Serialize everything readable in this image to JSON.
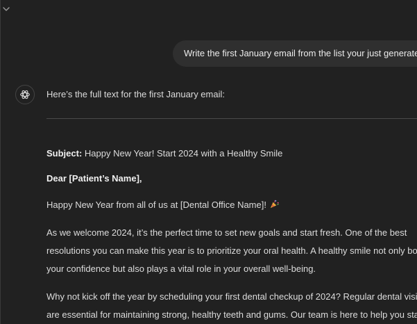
{
  "user_message": "Write the first January email from the list your just generated",
  "assistant": {
    "intro": "Here’s the full text for the first January email:",
    "email": {
      "subject_label": "Subject:",
      "subject_text": " Happy New Year! Start 2024 with a Healthy Smile",
      "greeting": "Dear [Patient’s Name],",
      "new_year_line": "Happy New Year from all of us at [Dental Office Name]!",
      "party_emoji": "party-popper-icon",
      "paragraph1": [
        "As we welcome 2024, it’s the perfect time to set new goals and start fresh. One of the best",
        "resolutions you can make this year is to prioritize your oral health. A healthy smile not only boosts",
        "your confidence but also plays a vital role in your overall well-being."
      ],
      "paragraph2": [
        "Why not kick off the year by scheduling your first dental checkup of 2024? Regular dental visits",
        "are essential for maintaining strong, healthy teeth and gums. Our team is here to help you stay"
      ]
    }
  },
  "colors": {
    "background": "#212121",
    "bubble": "#2f2f2f",
    "text": "#dcdcdc"
  }
}
